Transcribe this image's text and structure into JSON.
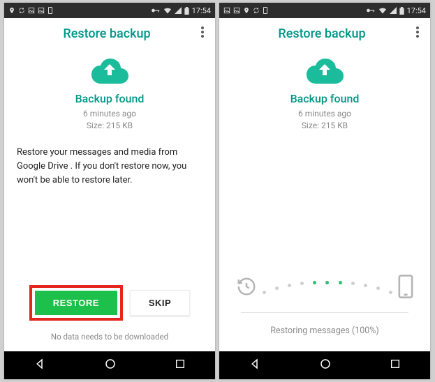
{
  "statusbar": {
    "time": "17:54"
  },
  "left": {
    "appbar": {
      "title": "Restore backup"
    },
    "heading": "Backup found",
    "meta_time": "6 minutes ago",
    "meta_size": "Size: 215 KB",
    "body": "Restore your messages and media from Google Drive . If you don't restore now, you won't be able to restore later.",
    "restore_label": "RESTORE",
    "skip_label": "SKIP",
    "footnote": "No data needs to be downloaded"
  },
  "right": {
    "appbar": {
      "title": "Restore backup"
    },
    "heading": "Backup found",
    "meta_time": "6 minutes ago",
    "meta_size": "Size: 215 KB",
    "status": "Restoring messages (100%)"
  },
  "colors": {
    "accent": "#009788",
    "green": "#1cc04a",
    "highlight": "#e4261e"
  }
}
